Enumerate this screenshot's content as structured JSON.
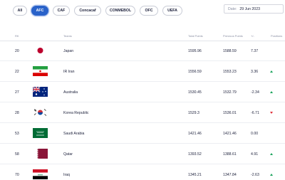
{
  "tabs": [
    {
      "label": "All",
      "active": false
    },
    {
      "label": "AFC",
      "active": true
    },
    {
      "label": "CAF",
      "active": false
    },
    {
      "label": "Concacaf",
      "active": false
    },
    {
      "label": "CONMEBOL",
      "active": false
    },
    {
      "label": "OFC",
      "active": false
    },
    {
      "label": "UEFA",
      "active": false
    }
  ],
  "date": {
    "label": "Date:",
    "value": "29 Jun 2023"
  },
  "columns": {
    "rk": "RK",
    "teams": "Teams",
    "total_points": "Total Points",
    "previous_points": "Previous Points",
    "change": "+/-",
    "positions": "Positions"
  },
  "rows": [
    {
      "rank": "20",
      "team": "Japan",
      "total": "1595.96",
      "previous": "1588.59",
      "change": "7.37",
      "trend": "none",
      "flag": "japan-flag"
    },
    {
      "rank": "22",
      "team": "IR Iran",
      "total": "1556.59",
      "previous": "1553.23",
      "change": "3.36",
      "trend": "up",
      "flag": "iran-flag"
    },
    {
      "rank": "27",
      "team": "Australia",
      "total": "1530.45",
      "previous": "1532.79",
      "change": "-2.34",
      "trend": "up",
      "flag": "australia-flag"
    },
    {
      "rank": "28",
      "team": "Korea Republic",
      "total": "1529.3",
      "previous": "1536.01",
      "change": "-6.71",
      "trend": "down",
      "flag": "korea-flag"
    },
    {
      "rank": "53",
      "team": "Saudi Arabia",
      "total": "1421.46",
      "previous": "1421.46",
      "change": "0.00",
      "trend": "none",
      "flag": "saudi-flag"
    },
    {
      "rank": "58",
      "team": "Qatar",
      "total": "1393.52",
      "previous": "1388.61",
      "change": "4.91",
      "trend": "up",
      "flag": "qatar-flag"
    },
    {
      "rank": "70",
      "team": "Iraq",
      "total": "1345.21",
      "previous": "1347.84",
      "change": "-2.63",
      "trend": "up",
      "flag": "iraq-flag"
    }
  ],
  "colors": {
    "accent": "#2962c9",
    "up": "#1aa35c",
    "down": "#e0313c"
  }
}
